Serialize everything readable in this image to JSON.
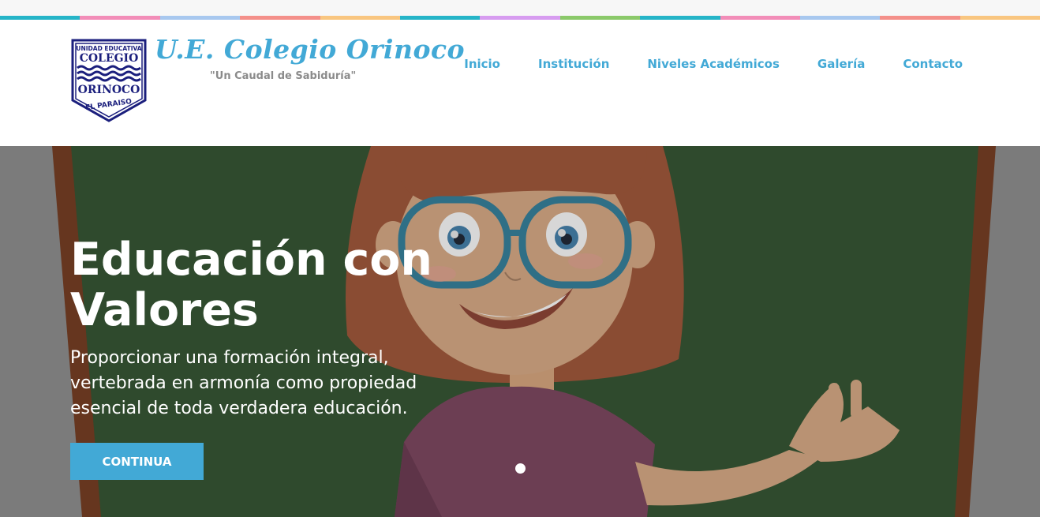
{
  "brand": {
    "title": "U.E. Colegio Orinoco",
    "slogan": "\"Un Caudal de Sabiduría\"",
    "logo": {
      "line1": "UNIDAD EDUCATIVA",
      "line2": "COLEGIO",
      "line3": "ORINOCO",
      "line4": "EL PARAISO"
    }
  },
  "nav": {
    "items": [
      "Inicio",
      "Institución",
      "Niveles Académicos",
      "Galería",
      "Contacto"
    ]
  },
  "hero": {
    "title": "Educación con Valores",
    "text": "Proporcionar una formación integral, vertebrada en armonía como propiedad esencial de toda verdadera educación.",
    "button_label": "CONTINUA"
  },
  "colors": {
    "accent": "#42a9d6",
    "logo_navy": "#1b1f7d",
    "stripe": [
      "#26b5c8",
      "#f28db8",
      "#a8c8ef",
      "#f4908a",
      "#f9c680",
      "#26b5c8",
      "#d79cf0",
      "#8bc96a",
      "#26b5c8",
      "#f28db8",
      "#a8c8ef",
      "#f4908a",
      "#f9c680"
    ]
  },
  "icons": {
    "logo": "school-crest-icon"
  }
}
